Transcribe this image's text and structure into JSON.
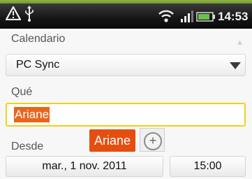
{
  "status_bar": {
    "time": "14:53",
    "icons": [
      "warning-icon",
      "usb-icon",
      "wifi-icon",
      "signal-icon",
      "battery-icon"
    ]
  },
  "form": {
    "calendar_label": "Calendario",
    "calendar_value": "PC Sync",
    "what_label": "Qué",
    "what_value": "Ariane",
    "from_label": "Desde",
    "from_date": "mar., 1 nov. 2011",
    "from_time": "15:00"
  },
  "suggestion": {
    "word": "Ariane",
    "add_glyph": "+"
  },
  "colors": {
    "highlight": "#e8651c",
    "focus_border": "#f0d21a",
    "status_bar": "#151515"
  }
}
